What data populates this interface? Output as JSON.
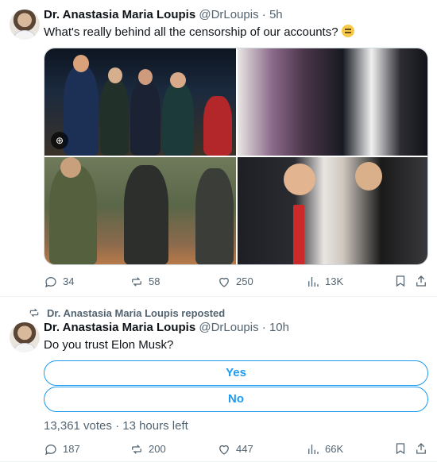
{
  "colors": {
    "accent": "#1d9bf0",
    "muted": "#536471",
    "text": "#0f1419"
  },
  "tweet1": {
    "name": "Dr. Anastasia Maria Loupis",
    "handle": "@DrLoupis",
    "sep": "·",
    "time": "5h",
    "text": "What's really behind all the censorship of our accounts?",
    "emoji": "thinking-face",
    "alt_badge": "⊕",
    "stats": {
      "replies": "34",
      "reposts": "58",
      "likes": "250",
      "views": "13K"
    }
  },
  "tweet2": {
    "repost_label": "Dr. Anastasia Maria Loupis reposted",
    "name": "Dr. Anastasia Maria Loupis",
    "handle": "@DrLoupis",
    "sep": "·",
    "time": "10h",
    "text": "Do you trust Elon Musk?",
    "poll": {
      "options": [
        "Yes",
        "No"
      ],
      "meta": "13,361 votes · 13 hours left"
    },
    "stats": {
      "replies": "187",
      "reposts": "200",
      "likes": "447",
      "views": "66K"
    }
  },
  "icons": [
    "reply-icon",
    "repost-icon",
    "like-icon",
    "views-icon",
    "bookmark-icon",
    "share-icon"
  ]
}
